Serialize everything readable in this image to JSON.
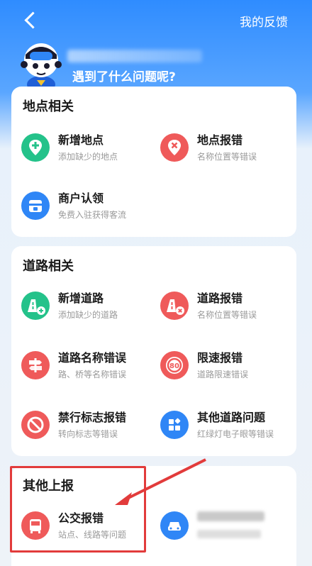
{
  "header": {
    "feedback_label": "我的反馈",
    "question": "遇到了什么问题呢?"
  },
  "sections": [
    {
      "title": "地点相关",
      "items": [
        {
          "title": "新增地点",
          "sub": "添加缺少的地点",
          "icon": "plus-pin-icon",
          "color": "#24c28a"
        },
        {
          "title": "地点报错",
          "sub": "名称位置等错误",
          "icon": "location-error-icon",
          "color": "#ef5a5a"
        },
        {
          "title": "商户认领",
          "sub": "免费入驻获得客流",
          "icon": "store-icon",
          "color": "#2f86f6"
        }
      ]
    },
    {
      "title": "道路相关",
      "items": [
        {
          "title": "新增道路",
          "sub": "添加缺少的道路",
          "icon": "road-add-icon",
          "color": "#24c28a"
        },
        {
          "title": "道路报错",
          "sub": "名称位置等错误",
          "icon": "road-error-icon",
          "color": "#ef5a5a"
        },
        {
          "title": "道路名称错误",
          "sub": "路、桥等名称错误",
          "icon": "signpost-icon",
          "color": "#ef5a5a"
        },
        {
          "title": "限速报错",
          "sub": "道路限速错误",
          "icon": "speed-limit-icon",
          "color": "#ef5a5a"
        },
        {
          "title": "禁行标志报错",
          "sub": "转向标志等错误",
          "icon": "no-entry-icon",
          "color": "#ef5a5a"
        },
        {
          "title": "其他道路问题",
          "sub": "红绿灯电子眼等错误",
          "icon": "grid-icon",
          "color": "#2f86f6"
        }
      ]
    },
    {
      "title": "其他上报",
      "items": [
        {
          "title": "公交报错",
          "sub": "站点、线路等问题",
          "icon": "bus-icon",
          "color": "#ef5a5a"
        },
        {
          "icon": "car-icon",
          "color": "#2f86f6"
        }
      ]
    }
  ]
}
